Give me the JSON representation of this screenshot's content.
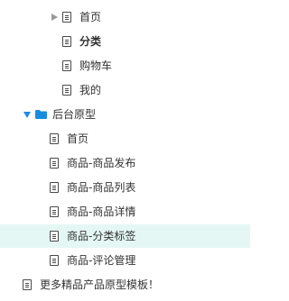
{
  "tree": {
    "items": [
      {
        "label": "首页",
        "icon": "page-icon",
        "expander": "collapsed-arrow",
        "bold": false,
        "selected": false
      },
      {
        "label": "分类",
        "icon": "page-icon",
        "expander": "none",
        "bold": true,
        "selected": false
      },
      {
        "label": "购物车",
        "icon": "page-icon",
        "expander": "none",
        "bold": false,
        "selected": false
      },
      {
        "label": "我的",
        "icon": "page-icon",
        "expander": "none",
        "bold": false,
        "selected": false
      },
      {
        "label": "后台原型",
        "icon": "folder-icon",
        "expander": "expanded-arrow",
        "bold": false,
        "selected": false
      },
      {
        "label": "首页",
        "icon": "page-icon",
        "expander": "none",
        "bold": false,
        "selected": false
      },
      {
        "label": "商品-商品发布",
        "icon": "page-icon",
        "expander": "none",
        "bold": false,
        "selected": false
      },
      {
        "label": "商品-商品列表",
        "icon": "page-icon",
        "expander": "none",
        "bold": false,
        "selected": false
      },
      {
        "label": "商品-商品详情",
        "icon": "page-icon",
        "expander": "none",
        "bold": false,
        "selected": false
      },
      {
        "label": "商品-分类标签",
        "icon": "page-icon",
        "expander": "none",
        "bold": false,
        "selected": true
      },
      {
        "label": "商品-评论管理",
        "icon": "page-icon",
        "expander": "none",
        "bold": false,
        "selected": false
      },
      {
        "label": "更多精品产品原型模板！",
        "icon": "page-icon",
        "expander": "none",
        "bold": false,
        "selected": false
      }
    ]
  },
  "colors": {
    "selected_row_background": "#e4f7f4",
    "folder_blue": "#1a8ce0",
    "arrow_gray": "#999999",
    "icon_gray": "#4a4a4a",
    "text": "#333333"
  }
}
